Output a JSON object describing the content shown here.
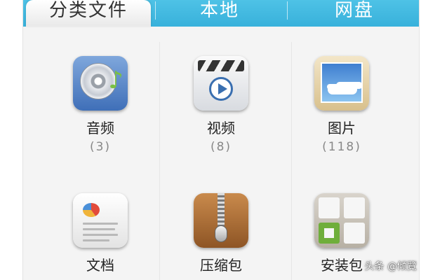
{
  "tabs": [
    {
      "label": "分类文件",
      "active": true
    },
    {
      "label": "本地",
      "active": false
    },
    {
      "label": "网盘",
      "active": false
    }
  ],
  "categories": [
    {
      "label": "音频",
      "count": "(3)",
      "icon": "audio-cd-icon"
    },
    {
      "label": "视频",
      "count": "(8)",
      "icon": "video-clapper-icon"
    },
    {
      "label": "图片",
      "count": "(118)",
      "icon": "picture-icon"
    },
    {
      "label": "文档",
      "icon": "document-icon"
    },
    {
      "label": "压缩包",
      "icon": "zip-icon"
    },
    {
      "label": "安装包",
      "icon": "package-icon"
    }
  ],
  "watermark": "头条 @倾覽",
  "colors": {
    "tab_bar": "#38b1db",
    "active_tab": "#ffffff",
    "label_text": "#222222",
    "count_text": "#888888"
  }
}
